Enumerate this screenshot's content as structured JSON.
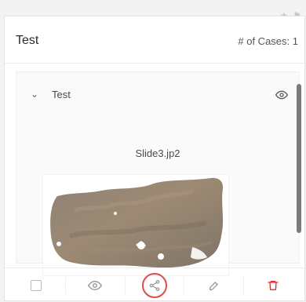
{
  "panel": {
    "title": "Test",
    "cases_label": "# of Cases: 1"
  },
  "group": {
    "label": "Test"
  },
  "slide": {
    "file_name": "Slide3.jp2"
  },
  "actions": {
    "delete_color": "#e12f2f",
    "share_highlight_color": "#e34a4a"
  },
  "icons": {
    "top_star": "star-icon",
    "top_flag": "flag-icon",
    "expand": "chevron-down-icon",
    "visibility": "eye-icon",
    "select": "checkbox-icon",
    "view": "eye-icon",
    "share": "share-icon",
    "edit": "pencil-icon",
    "delete": "trash-icon"
  }
}
